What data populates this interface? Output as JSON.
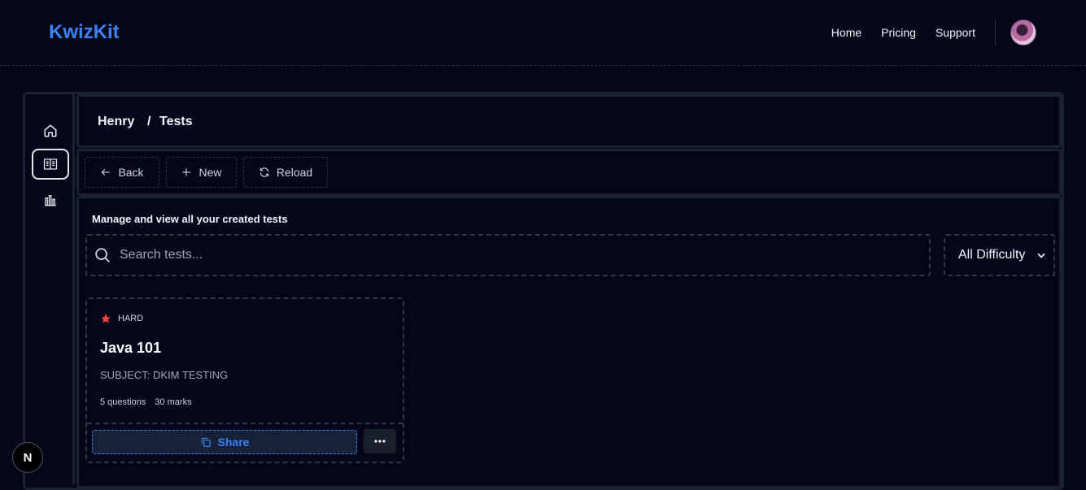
{
  "brand": {
    "name": "KwizKit",
    "accent": "#3b82f6"
  },
  "nav": {
    "home": "Home",
    "pricing": "Pricing",
    "support": "Support"
  },
  "sidebar": {
    "items": [
      {
        "icon": "home-icon"
      },
      {
        "icon": "book-open-icon",
        "active": true
      },
      {
        "icon": "bar-chart-icon"
      }
    ]
  },
  "breadcrumb": {
    "user": "Henry",
    "separator": "/",
    "page": "Tests"
  },
  "toolbar": {
    "back": "Back",
    "new": "New",
    "reload": "Reload"
  },
  "main": {
    "description": "Manage and view all your created tests",
    "search_placeholder": "Search tests...",
    "difficulty_selected": "All Difficulty"
  },
  "tests": [
    {
      "difficulty": "HARD",
      "difficulty_color": "#ef4444",
      "title": "Java 101",
      "subject": "SUBJECT: DKIM TESTING",
      "questions": "5 questions",
      "marks": "30 marks",
      "share_label": "Share"
    }
  ],
  "dev_badge": {
    "letter": "N"
  }
}
